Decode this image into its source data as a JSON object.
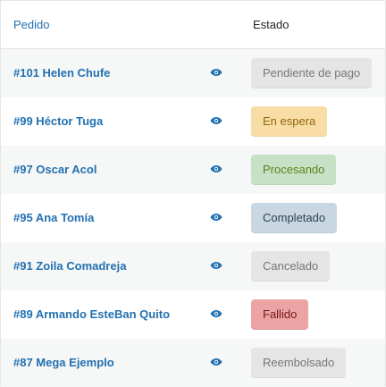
{
  "header": {
    "order_label": "Pedido",
    "status_label": "Estado"
  },
  "orders": [
    {
      "label": "#101 Helen Chufe",
      "status": "Pendiente de pago"
    },
    {
      "label": "#99 Héctor Tuga",
      "status": "En espera"
    },
    {
      "label": "#97 Oscar Acol",
      "status": "Procesando"
    },
    {
      "label": "#95 Ana Tomía",
      "status": "Completado"
    },
    {
      "label": "#91 Zoila Comadreja",
      "status": "Cancelado"
    },
    {
      "label": "#89 Armando EsteBan Quito",
      "status": "Fallido"
    },
    {
      "label": "#87 Mega Ejemplo",
      "status": "Reembolsado"
    }
  ],
  "icons": {
    "view": "eye-icon"
  },
  "colors": {
    "link": "#2271b1",
    "status_pending": "#e5e5e5",
    "status_on_hold": "#f8dda7",
    "status_processing": "#c6e1c6",
    "status_completed": "#c8d7e1",
    "status_cancelled": "#e5e5e5",
    "status_failed": "#eba3a3",
    "status_refunded": "#e5e5e5"
  }
}
